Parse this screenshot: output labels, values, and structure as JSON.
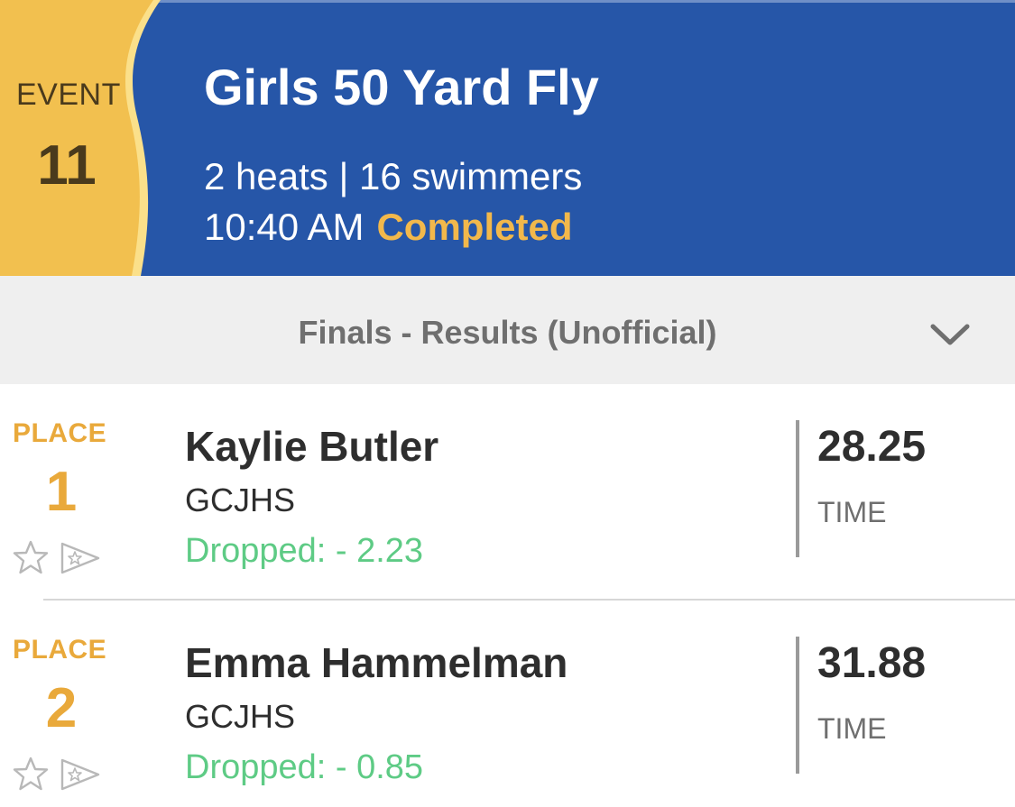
{
  "event": {
    "word": "EVENT",
    "number": "11",
    "title": "Girls 50 Yard Fly",
    "meta": "2 heats | 16 swimmers",
    "time": "10:40 AM",
    "status": "Completed"
  },
  "results_bar": {
    "label": "Finals - Results (Unofficial)",
    "chevron_icon": "chevron-down-icon"
  },
  "results": [
    {
      "place_label": "PLACE",
      "place": "1",
      "name": "Kaylie Butler",
      "team": "GCJHS",
      "dropped": "Dropped: - 2.23",
      "time": "28.25",
      "time_label": "TIME"
    },
    {
      "place_label": "PLACE",
      "place": "2",
      "name": "Emma Hammelman",
      "team": "GCJHS",
      "dropped": "Dropped: - 0.85",
      "time": "31.88",
      "time_label": "TIME"
    }
  ],
  "colors": {
    "header_blue": "#2656a8",
    "tab_gold": "#f2c04f",
    "accent_orange": "#e9a93b",
    "drop_green": "#5ecb85"
  }
}
